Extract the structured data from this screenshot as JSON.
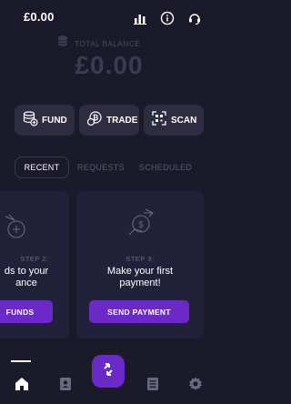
{
  "header": {
    "balance": "£0.00",
    "icons": [
      "bar-chart-icon",
      "info-icon",
      "support-headset-icon"
    ]
  },
  "summary": {
    "total_label": "TOTAL BALANCE",
    "total_value": "£0.00"
  },
  "actions": [
    {
      "label": "FUND",
      "icon": "coins-plus-icon"
    },
    {
      "label": "TRADE",
      "icon": "bitcoin-exchange-icon"
    },
    {
      "label": "SCAN",
      "icon": "qr-scan-icon"
    }
  ],
  "tabs": [
    {
      "label": "RECENT",
      "active": true
    },
    {
      "label": "REQUESTS",
      "active": false
    },
    {
      "label": "SCHEDULED",
      "active": false
    }
  ],
  "cards": [
    {
      "step": "STEP 2:",
      "headline_line1": "ds to your",
      "headline_line2": "ance",
      "cta": "FUNDS"
    },
    {
      "step": "STEP 3:",
      "headline_line1": "Make your first",
      "headline_line2": "payment!",
      "cta": "SEND PAYMENT"
    }
  ],
  "bottom_nav": {
    "items": [
      "home-icon",
      "contacts-book-icon",
      "transfer-icon",
      "statement-list-icon",
      "settings-gear-icon"
    ]
  },
  "colors": {
    "background": "#1b1a2b",
    "card": "#22213a",
    "accent": "#6b29c8"
  }
}
